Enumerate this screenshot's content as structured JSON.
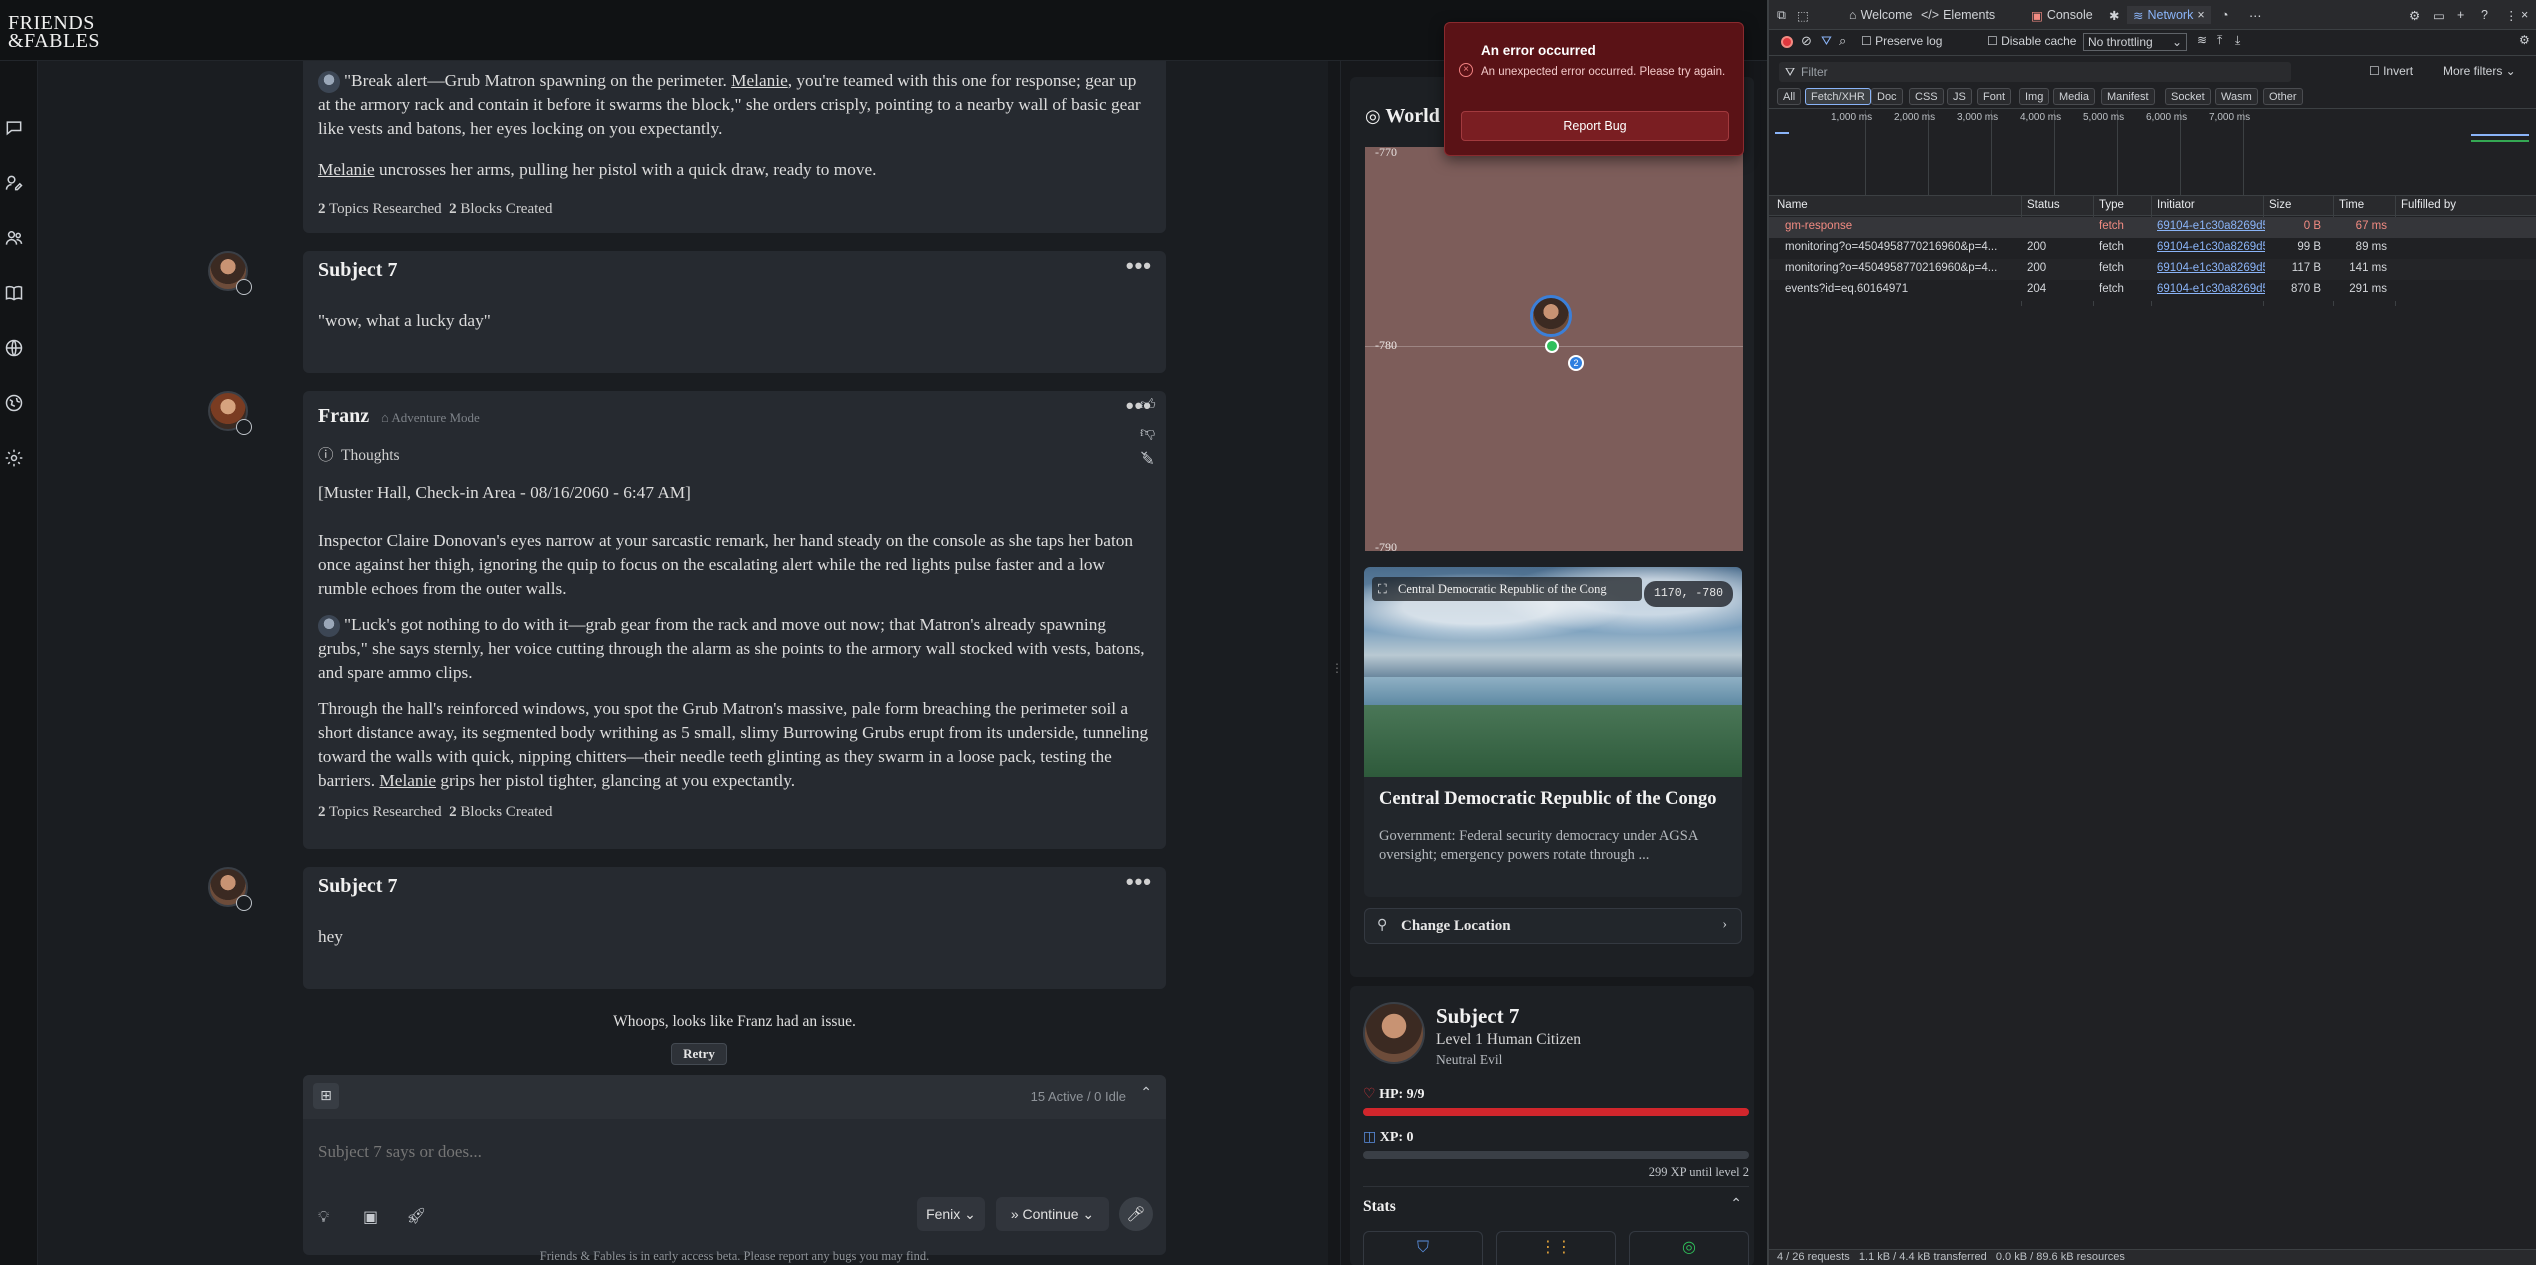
{
  "app": {
    "logo": "FRIENDS & FABLES",
    "user_initial": "P",
    "footer": "Friends & Fables is in early access beta. Please report any bugs you may find."
  },
  "chat": {
    "messages": [
      {
        "speaker": "",
        "paragraphs": [
          "\"Break alert—Grub Matron spawning on the perimeter. ",
          "Melanie",
          ", you're teamed with this one for response; gear up at the armory rack and contain it before it swarms the block,\"  she orders crisply, pointing to a nearby wall of basic gear like vests and batons, her eyes locking on you expectantly.",
          "Melanie",
          " uncrosses her arms, pulling her pistol with a quick draw, ready to move."
        ],
        "meta_topics": "2",
        "meta_topics_label": "Topics Researched",
        "meta_blocks": "2",
        "meta_blocks_label": "Blocks Created"
      },
      {
        "speaker": "Subject 7",
        "text": "\"wow, what a lucky day\""
      },
      {
        "speaker": "Franz",
        "mode": "Adventure Mode",
        "thoughts_label": "Thoughts",
        "header_line": "[Muster Hall, Check-in Area - 08/16/2060 - 6:47 AM]",
        "p1": "Inspector Claire Donovan's eyes narrow at your sarcastic remark, her hand steady on the console as she taps her baton once against her thigh, ignoring the quip to focus on the escalating alert while the red lights pulse faster and a low rumble echoes from the outer walls.",
        "p2": "\"Luck's got nothing to do with it—grab gear from the rack and move out now; that Matron's already spawning grubs,\"  she says sternly, her voice cutting through the alarm as she points to the armory wall stocked with vests, batons, and spare ammo clips.",
        "p3a": "Through the hall's reinforced windows, you spot the Grub Matron's massive, pale form breaching the perimeter soil a short distance away, its segmented body writhing as 5 small, slimy Burrowing Grubs erupt from its underside, tunneling toward the walls with quick, nipping chitters—their needle teeth glinting as they swarm in a loose pack, testing the barriers. ",
        "p3b": "Melanie",
        "p3c": " grips her pistol tighter, glancing at you expectantly.",
        "meta_topics": "2",
        "meta_topics_label": "Topics Researched",
        "meta_blocks": "2",
        "meta_blocks_label": "Blocks Created"
      },
      {
        "speaker": "Subject 7",
        "text": "hey"
      }
    ],
    "error_line": "Whoops, looks like Franz had an issue.",
    "retry_label": "Retry",
    "composer": {
      "status": "15 Active / 0 Idle",
      "placeholder": "Subject 7 says or does...",
      "model": "Fenix",
      "continue_label": "Continue"
    }
  },
  "world": {
    "title": "World",
    "map_ticks": [
      "-770",
      "-780",
      "-790"
    ],
    "marker_count": "2",
    "location_name_short": "Central Democratic Republic of the Cong",
    "coords": "1170, -780",
    "location_title": "Central Democratic Republic of the Congo",
    "location_desc": "Government: Federal security democracy under AGSA oversight; emergency powers rotate through ...",
    "change_location": "Change Location"
  },
  "character": {
    "name": "Subject 7",
    "level_line": "Level 1 Human Citizen",
    "alignment": "Neutral Evil",
    "hp_label": "HP: 9/9",
    "hp_fraction": 1.0,
    "xp_label": "XP: 0",
    "xp_fraction": 0.0,
    "xp_until": "299 XP until level 2",
    "stats_label": "Stats"
  },
  "toast": {
    "title": "An error occurred",
    "message": "An unexpected error occurred. Please try again.",
    "button": "Report Bug"
  },
  "devtools": {
    "tabs": [
      "Welcome",
      "Elements",
      "Console",
      "Network"
    ],
    "throttle": "No throttling",
    "preserve_log": "Preserve log",
    "disable_cache": "Disable cache",
    "filter_placeholder": "Filter",
    "invert": "Invert",
    "more_filters": "More filters",
    "type_chips": [
      "All",
      "Fetch/XHR",
      "Doc",
      "CSS",
      "JS",
      "Font",
      "Img",
      "Media",
      "Manifest",
      "Socket",
      "Wasm",
      "Other"
    ],
    "timeline_ticks": [
      "1,000 ms",
      "2,000 ms",
      "3,000 ms",
      "4,000 ms",
      "5,000 ms",
      "6,000 ms",
      "7,000 ms"
    ],
    "columns": [
      "Name",
      "Status",
      "Type",
      "Initiator",
      "Size",
      "Time",
      "Fulfilled by"
    ],
    "rows": [
      {
        "name": "gm-response",
        "status": "",
        "type": "fetch",
        "initiator": "69104-e1c30a8269d5e",
        "size": "0 B",
        "time": "67 ms",
        "error": true
      },
      {
        "name": "monitoring?o=4504958770216960&p=4...",
        "status": "200",
        "type": "fetch",
        "initiator": "69104-e1c30a8269d5e",
        "size": "99 B",
        "time": "89 ms",
        "error": false
      },
      {
        "name": "monitoring?o=4504958770216960&p=4...",
        "status": "200",
        "type": "fetch",
        "initiator": "69104-e1c30a8269d5e",
        "size": "117 B",
        "time": "141 ms",
        "error": false
      },
      {
        "name": "events?id=eq.60164971",
        "status": "204",
        "type": "fetch",
        "initiator": "69104-e1c30a8269d5e",
        "size": "870 B",
        "time": "291 ms",
        "error": false
      }
    ],
    "status_bar": "4 / 26 requests   1.1 kB / 4.4 kB transferred   0.0 kB / 89.6 kB resources"
  }
}
